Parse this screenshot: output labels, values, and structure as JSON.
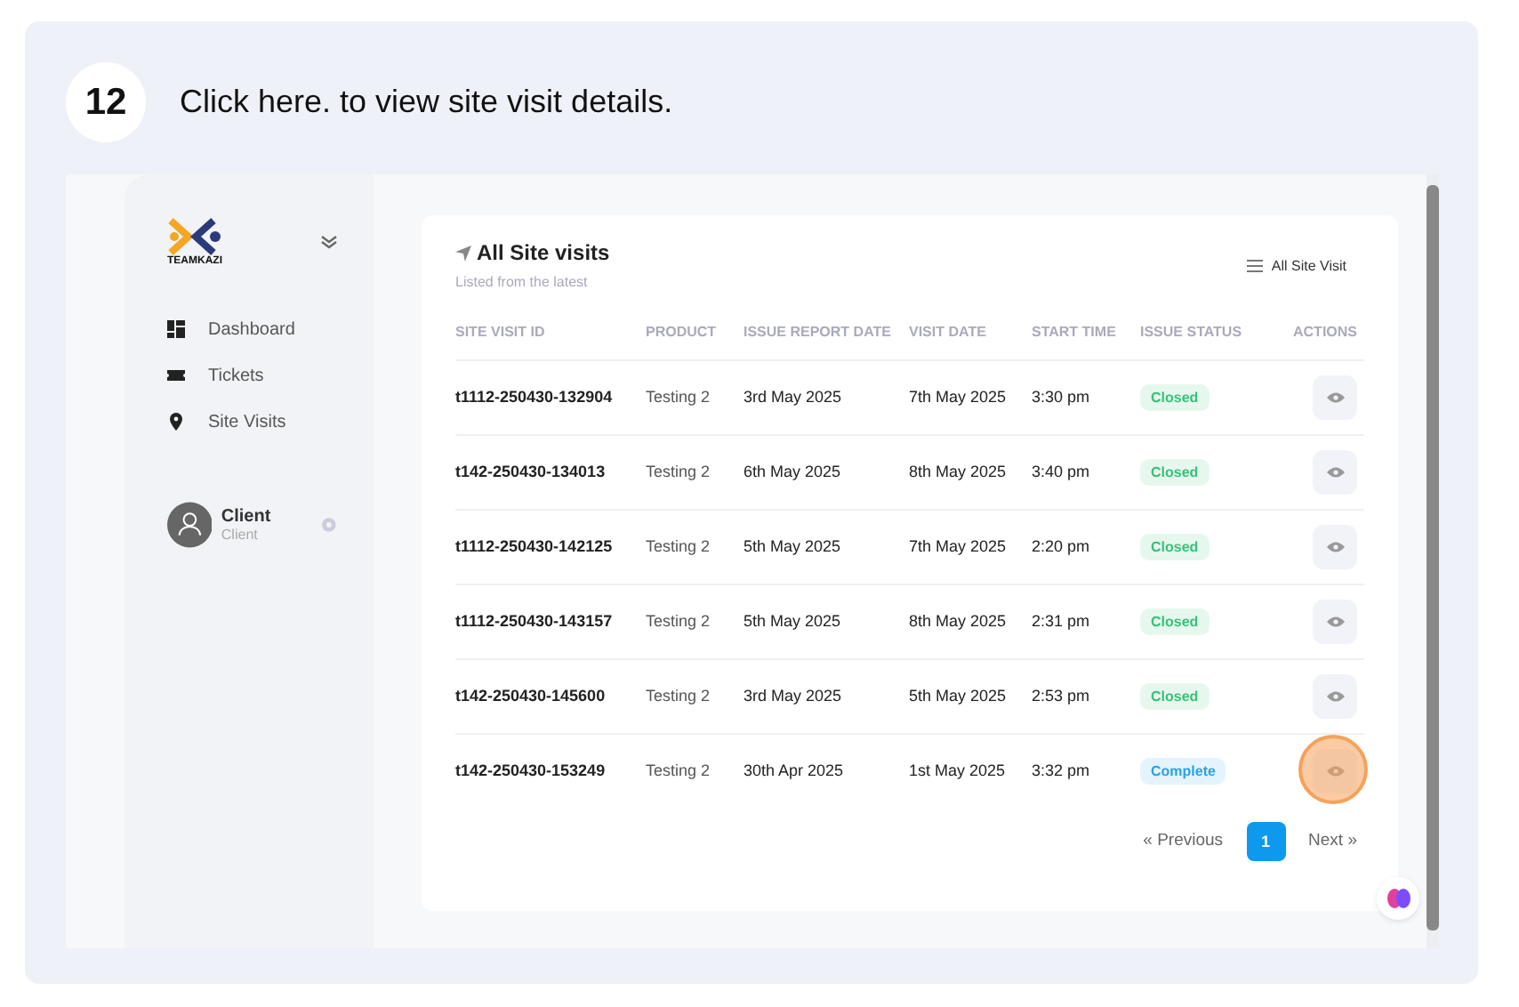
{
  "step": {
    "number": "12",
    "instruction": "Click here. to view site visit details."
  },
  "sidebar": {
    "logo_text": "TEAMKAZI",
    "items": [
      {
        "label": "Dashboard"
      },
      {
        "label": "Tickets"
      },
      {
        "label": "Site Visits"
      }
    ],
    "user": {
      "name": "Client",
      "role": "Client"
    }
  },
  "card": {
    "title": "All Site visits",
    "subtitle": "Listed from the latest",
    "filter": "All Site Visit",
    "columns": [
      "SITE VISIT ID",
      "PRODUCT",
      "ISSUE REPORT DATE",
      "VISIT DATE",
      "START TIME",
      "ISSUE STATUS",
      "ACTIONS"
    ],
    "rows": [
      {
        "id": "t1112-250430-132904",
        "product": "Testing 2",
        "report_date": "3rd May 2025",
        "visit_date": "7th May 2025",
        "start_time": "3:30 pm",
        "status": "Closed",
        "kind": "closed",
        "highlighted": false
      },
      {
        "id": "t142-250430-134013",
        "product": "Testing 2",
        "report_date": "6th May 2025",
        "visit_date": "8th May 2025",
        "start_time": "3:40 pm",
        "status": "Closed",
        "kind": "closed",
        "highlighted": false
      },
      {
        "id": "t1112-250430-142125",
        "product": "Testing 2",
        "report_date": "5th May 2025",
        "visit_date": "7th May 2025",
        "start_time": "2:20 pm",
        "status": "Closed",
        "kind": "closed",
        "highlighted": false
      },
      {
        "id": "t1112-250430-143157",
        "product": "Testing 2",
        "report_date": "5th May 2025",
        "visit_date": "8th May 2025",
        "start_time": "2:31 pm",
        "status": "Closed",
        "kind": "closed",
        "highlighted": false
      },
      {
        "id": "t142-250430-145600",
        "product": "Testing 2",
        "report_date": "3rd May 2025",
        "visit_date": "5th May 2025",
        "start_time": "2:53 pm",
        "status": "Closed",
        "kind": "closed",
        "highlighted": false
      },
      {
        "id": "t142-250430-153249",
        "product": "Testing 2",
        "report_date": "30th Apr 2025",
        "visit_date": "1st May 2025",
        "start_time": "3:32 pm",
        "status": "Complete",
        "kind": "complete",
        "highlighted": true
      }
    ],
    "pagination": {
      "previous": "« Previous",
      "pages": [
        {
          "label": "1",
          "selected": true
        }
      ],
      "next": "Next »"
    }
  }
}
